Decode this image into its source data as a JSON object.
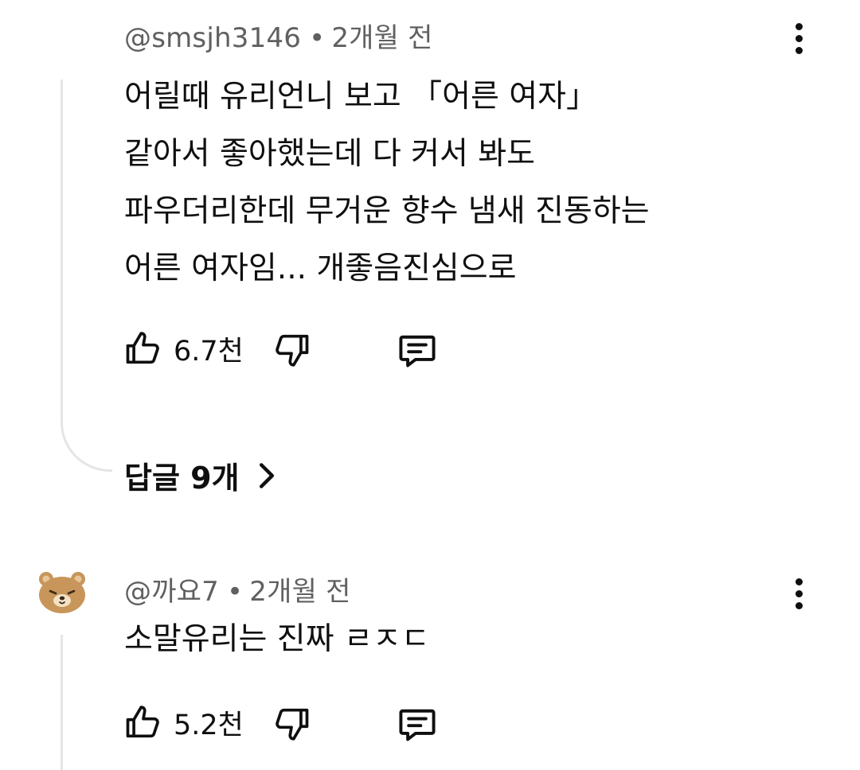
{
  "comments": [
    {
      "handle": "@smsjh3146",
      "separator": "•",
      "time": "2개월 전",
      "text": "어릴때 유리언니 보고 「어른 여자」\n같아서 좋아했는데 다 커서 봐도\n파우더리한데 무거운 향수 냄새 진동하는\n어른 여자임... 개좋음진심으로",
      "likes": "6.7천",
      "replies_label": "답글 9개"
    },
    {
      "handle": "@까요7",
      "separator": "•",
      "time": "2개월 전",
      "text": "소말유리는 진짜 ㄹㅈㄷ",
      "likes": "5.2천"
    }
  ],
  "icons": {
    "like": "thumbs-up-icon",
    "dislike": "thumbs-down-icon",
    "reply": "comment-icon",
    "more": "more-vert-icon",
    "expand": "chevron-right-icon",
    "avatar": "bear-avatar"
  },
  "colors": {
    "text": "#0f0f0f",
    "meta": "#606060",
    "thread_line": "#e5e5e5",
    "avatar_fur": "#c8965a"
  }
}
